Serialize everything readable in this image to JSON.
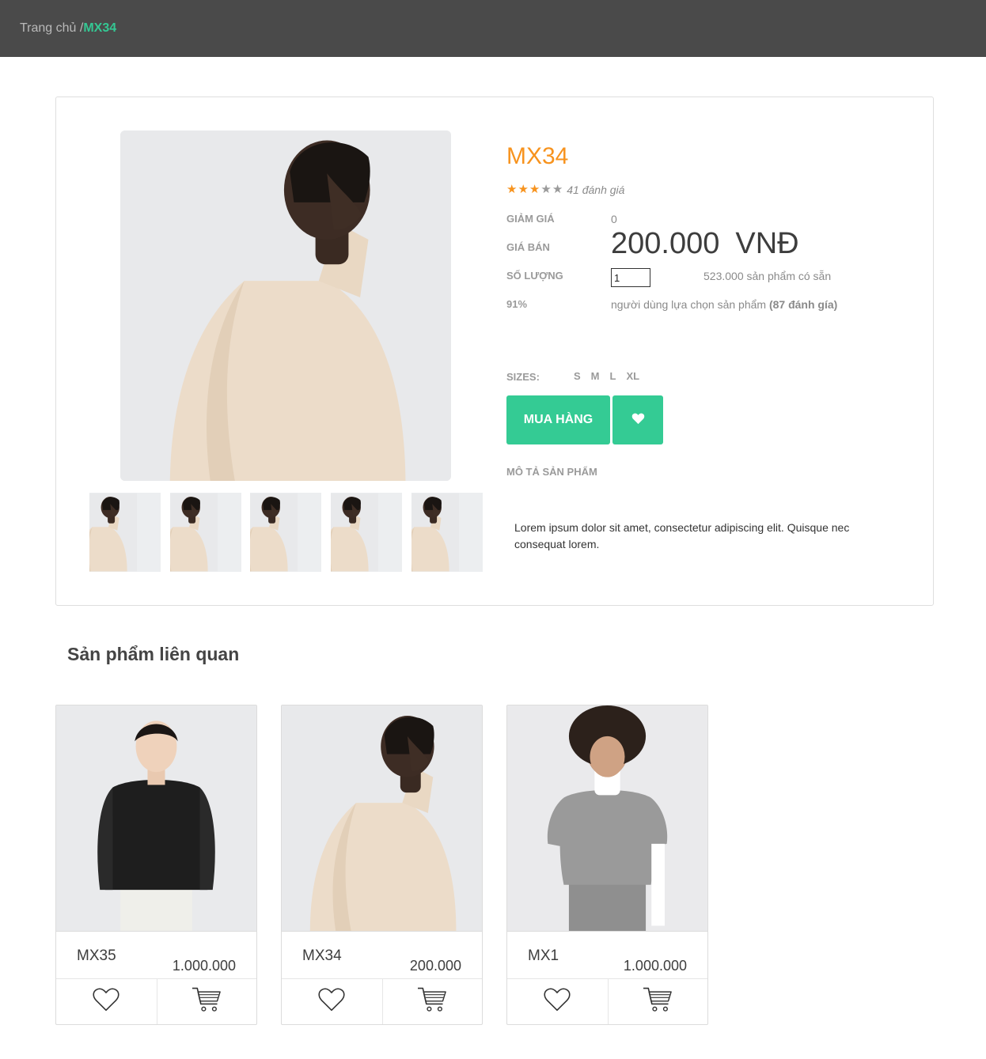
{
  "breadcrumb": {
    "home": "Trang chủ /",
    "current": "MX34"
  },
  "product": {
    "title": "MX34",
    "rating_stars": 3,
    "rating_max": 5,
    "rating_count": "41 đánh giá",
    "discount_label": "GIẢM GIÁ",
    "discount_value": "0",
    "price_label": "GIÁ BÁN",
    "price_value": "200.000",
    "price_currency": "VNĐ",
    "qty_label": "SỐ LƯỢNG",
    "qty_value": "1",
    "stock_text": "523.000 sản phẩm có sẵn",
    "percent": "91%",
    "choice_text": "người dùng lựa chọn sản phẩm",
    "choice_reviews": "(87 đánh gía)",
    "sizes_label": "SIZES:",
    "sizes": [
      "S",
      "M",
      "L",
      "XL"
    ],
    "buy_label": "MUA HÀNG",
    "desc_title": "MÔ TẢ SẢN PHẨM",
    "desc_text": "Lorem ipsum dolor sit amet, consectetur adipiscing elit. Quisque nec consequat lorem."
  },
  "related": {
    "title": "Sản phẩm liên quan",
    "items": [
      {
        "name": "MX35",
        "price": "1.000.000"
      },
      {
        "name": "MX34",
        "price": "200.000"
      },
      {
        "name": "MX1",
        "price": "1.000.000"
      }
    ]
  },
  "colors": {
    "topbar": "#4a4a4a",
    "accent": "#34cb94",
    "title": "#f7931e"
  },
  "icons": {
    "favorite": "heart-icon",
    "cart": "cart-icon",
    "star": "star-icon"
  }
}
